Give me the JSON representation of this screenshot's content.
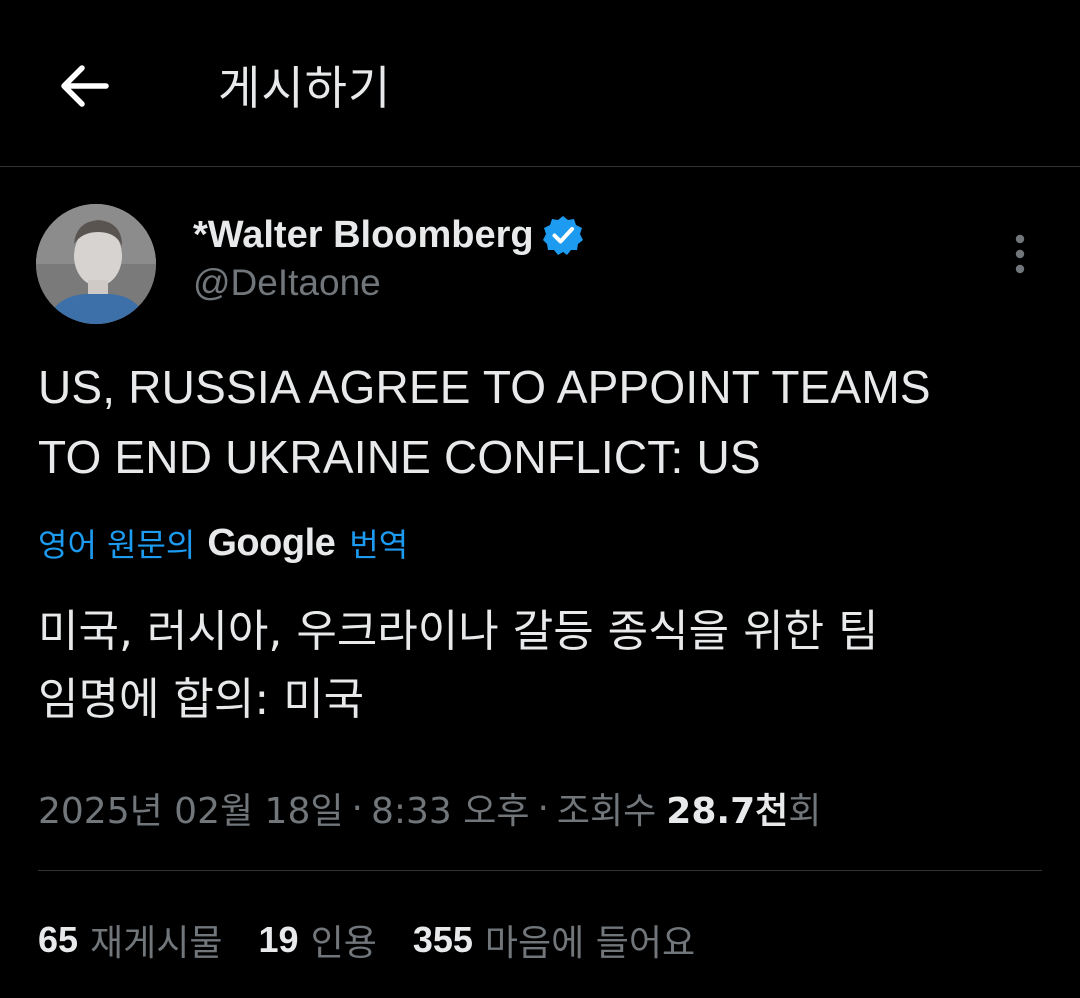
{
  "header": {
    "title": "게시하기",
    "back_icon": "arrow-left-icon"
  },
  "author": {
    "name": "*Walter Bloomberg",
    "handle": "@DeItaone",
    "verified_icon": "verified-badge-icon",
    "verified_color": "#1d9bf0",
    "more_icon": "more-vertical-icon"
  },
  "tweet": {
    "lines": [
      "US, RUSSIA AGREE TO APPOINT TEAMS",
      "TO END UKRAINE CONFLICT: US"
    ]
  },
  "translation": {
    "prefix": "영어 원문의",
    "provider": "Google",
    "suffix": "번역",
    "lines": [
      "미국, 러시아, 우크라이나 갈등 종식을 위한 팀",
      "임명에 합의: 미국"
    ],
    "link_color": "#1d9bf0"
  },
  "meta": {
    "date": "2025년 02월 18일",
    "time": "8:33 오후",
    "separator": "·",
    "views_label": "조회수",
    "views_count": "28.7천",
    "views_suffix": "회"
  },
  "stats": [
    {
      "count": "65",
      "label": "재게시물"
    },
    {
      "count": "19",
      "label": "인용"
    },
    {
      "count": "355",
      "label": "마음에 들어요"
    }
  ]
}
